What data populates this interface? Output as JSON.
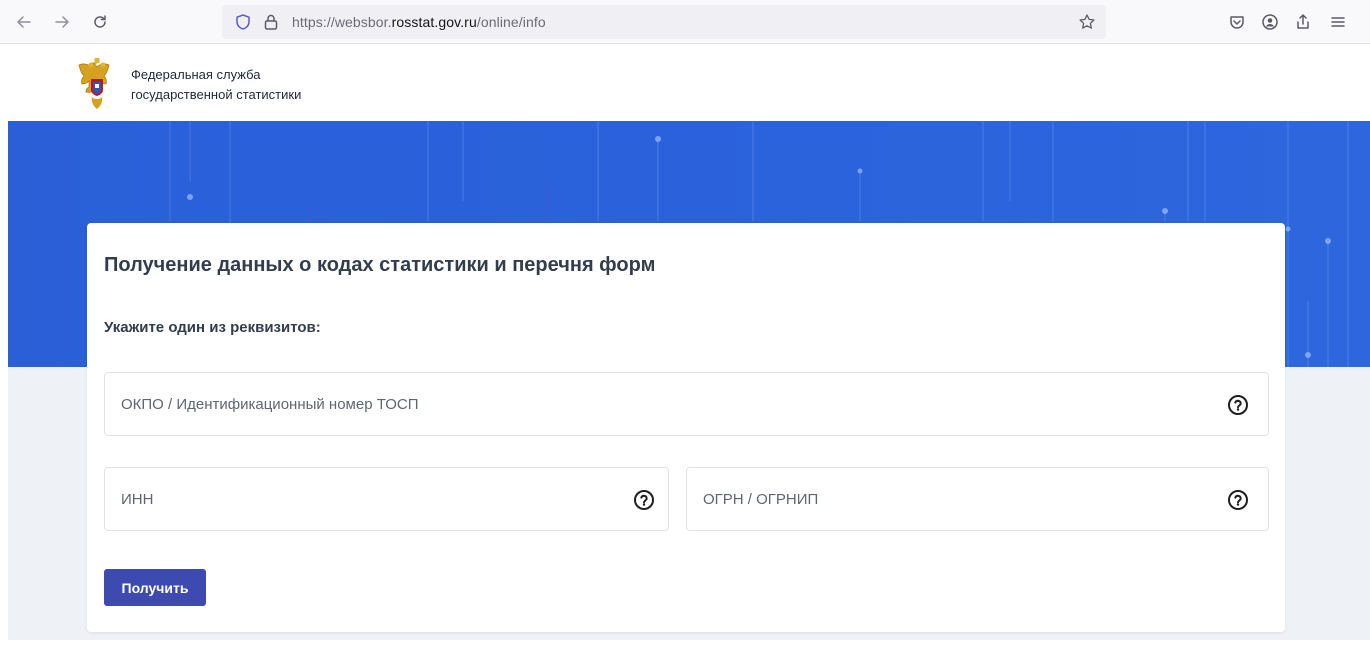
{
  "browser": {
    "url_prefix": "https://websbor.",
    "url_domain": "rosstat.gov.ru",
    "url_path": "/online/info",
    "icons": [
      "back-icon",
      "forward-icon",
      "reload-icon",
      "shield-icon",
      "lock-icon",
      "bookmark-star-icon",
      "pocket-icon",
      "account-icon",
      "share-icon",
      "menu-icon"
    ]
  },
  "header": {
    "org_line1": "Федеральная служба",
    "org_line2": "государственной статистики"
  },
  "form": {
    "title": "Получение данных о кодах статистики и перечня форм",
    "subtitle": "Укажите один из реквизитов:",
    "okpo_placeholder": "ОКПО / Идентификационный номер ТОСП",
    "okpo_value": "",
    "inn_placeholder": "ИНН",
    "inn_value": "",
    "ogrn_placeholder": "ОГРН / ОГРНИП",
    "ogrn_value": "",
    "submit_label": "Получить"
  },
  "colors": {
    "banner": "#2b63dc",
    "button": "#3d4aaf",
    "page_bg": "#eef1f5"
  }
}
